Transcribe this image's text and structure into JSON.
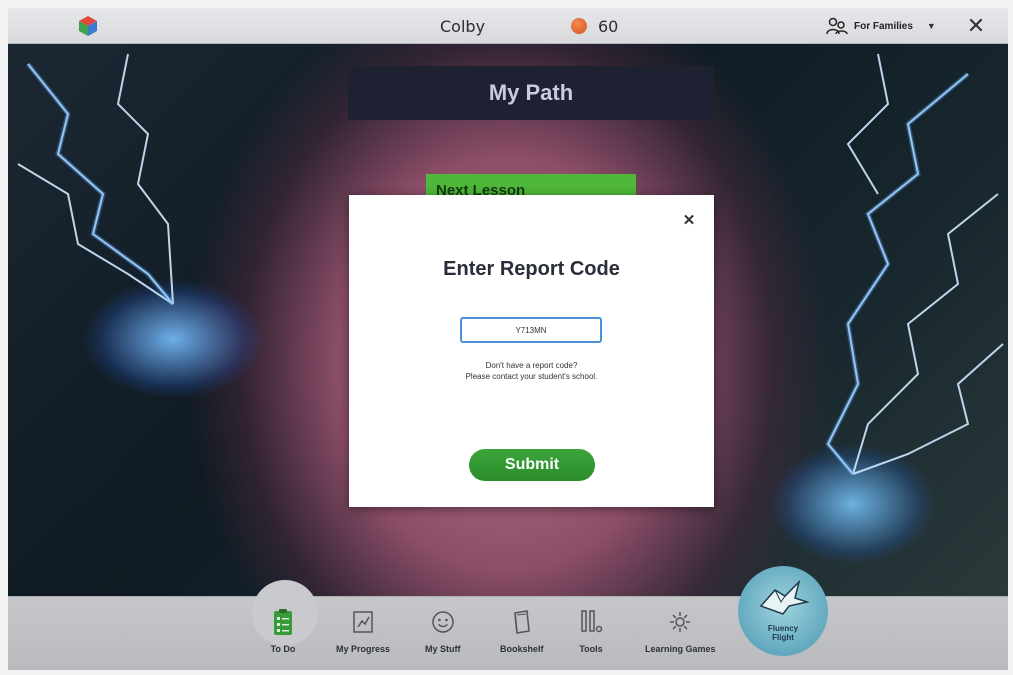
{
  "topbar": {
    "username": "Colby",
    "coins": "60",
    "families_label": "For Families"
  },
  "main": {
    "banner_title": "My Path",
    "next_lesson_label": "Next Lesson"
  },
  "modal": {
    "title": "Enter Report Code",
    "code_value": "Y713MN",
    "help_line1": "Don't have a report code?",
    "help_line2": "Please contact your student's school.",
    "submit_label": "Submit"
  },
  "nav": {
    "items": [
      {
        "label": "To Do",
        "icon": "todo-clipboard-icon"
      },
      {
        "label": "My Progress",
        "icon": "progress-chart-icon"
      },
      {
        "label": "My Stuff",
        "icon": "smiley-icon"
      },
      {
        "label": "Bookshelf",
        "icon": "book-icon"
      },
      {
        "label": "Tools",
        "icon": "tools-icon"
      },
      {
        "label": "Learning Games",
        "icon": "gamepad-icon"
      }
    ],
    "fluency_line1": "Fluency",
    "fluency_line2": "Flight"
  },
  "colors": {
    "banner_bg": "#1e2132",
    "submit_green": "#2b8d2b",
    "next_lesson_green": "#4fb83a",
    "coin_orange": "#e06a30",
    "fluency_teal": "#62a9bf"
  }
}
